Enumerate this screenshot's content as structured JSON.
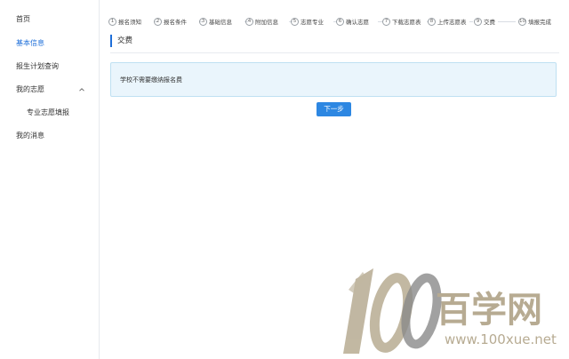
{
  "sidebar": {
    "items": [
      {
        "label": "首页"
      },
      {
        "label": "基本信息"
      },
      {
        "label": "报生计划查询"
      },
      {
        "label": "我的志愿"
      },
      {
        "label": "专业志愿填报"
      },
      {
        "label": "我的消息"
      }
    ]
  },
  "steps": [
    {
      "num": "1",
      "label": "报名须知"
    },
    {
      "num": "2",
      "label": "报名条件"
    },
    {
      "num": "3",
      "label": "基础信息"
    },
    {
      "num": "4",
      "label": "附加信息"
    },
    {
      "num": "5",
      "label": "志愿专业"
    },
    {
      "num": "6",
      "label": "确认志愿"
    },
    {
      "num": "7",
      "label": "下载志愿表"
    },
    {
      "num": "8",
      "label": "上传志愿表"
    },
    {
      "num": "9",
      "label": "交费"
    },
    {
      "num": "10",
      "label": "填报完成"
    }
  ],
  "section": {
    "title": "交费"
  },
  "notice": {
    "text": "学校不需要缴纳报名费"
  },
  "actions": {
    "next_label": "下一步"
  },
  "watermark": {
    "brand": "百学网",
    "url": "www.100xue.net",
    "logo_text": "100"
  },
  "colors": {
    "accent": "#1e6fd9",
    "button": "#2d87e2",
    "notice_bg": "#eaf5fc",
    "watermark": "#b7ab92"
  }
}
